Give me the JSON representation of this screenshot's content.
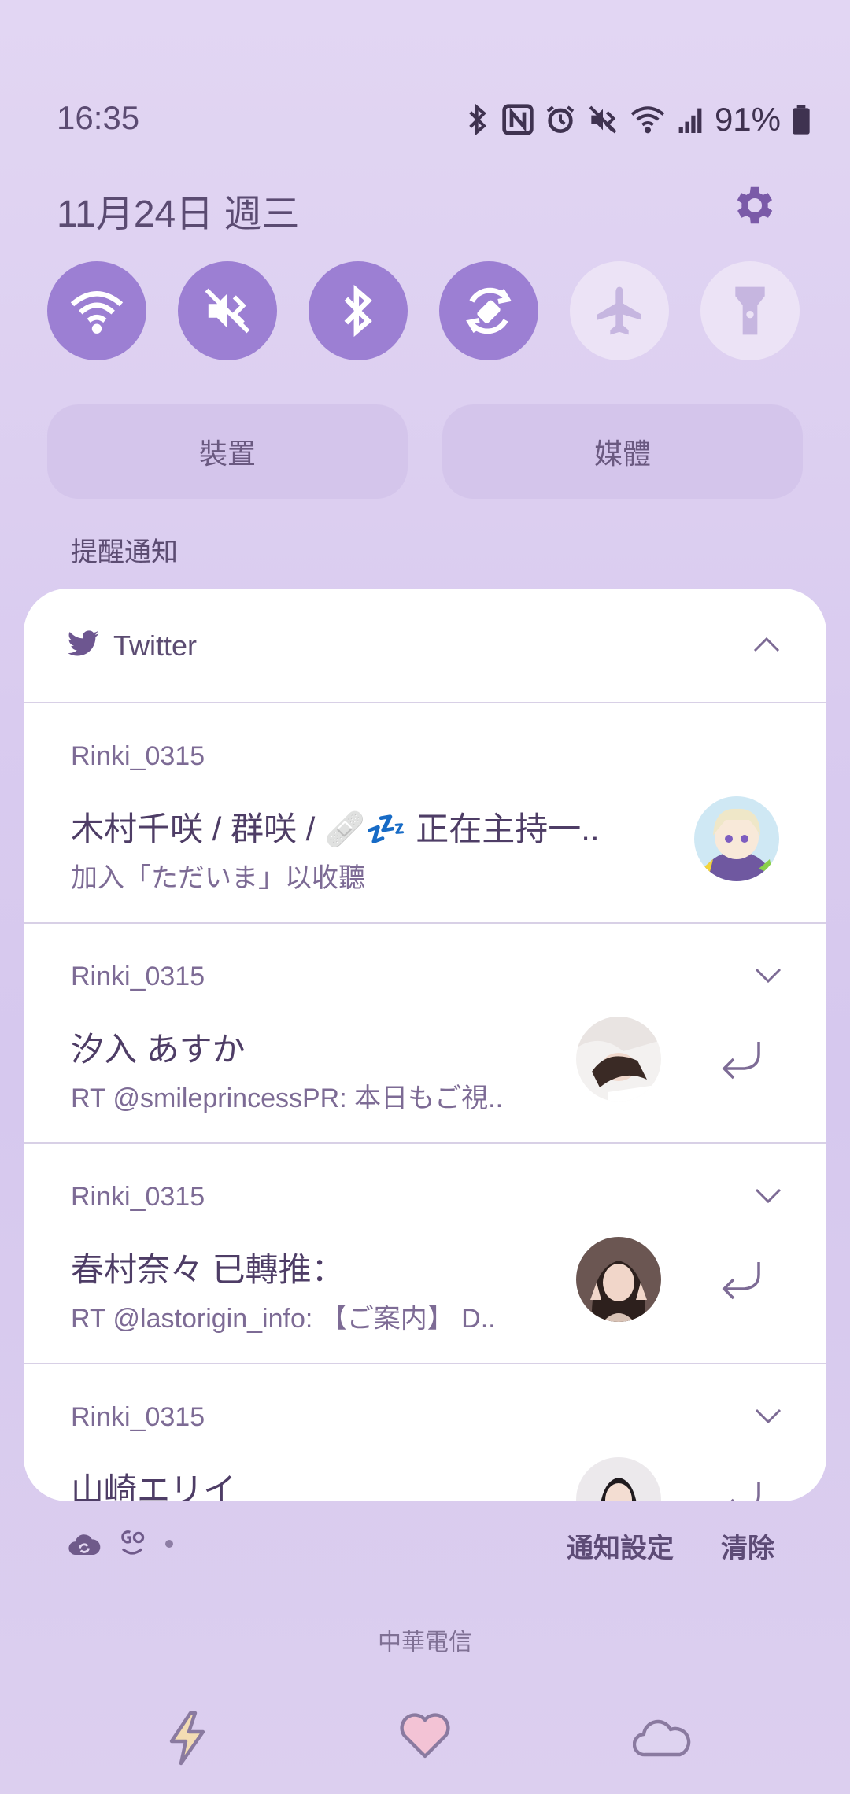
{
  "status_bar": {
    "time": "16:35",
    "battery": "91%",
    "icons": [
      "bluetooth-icon",
      "nfc-icon",
      "alarm-icon",
      "mute-icon",
      "wifi-icon",
      "signal-icon",
      "battery-icon"
    ]
  },
  "header": {
    "date": "11月24日 週三"
  },
  "quick_toggles": [
    {
      "name": "wifi",
      "state": "on"
    },
    {
      "name": "sound-mute",
      "state": "on"
    },
    {
      "name": "bluetooth",
      "state": "on"
    },
    {
      "name": "auto-rotate",
      "state": "on"
    },
    {
      "name": "airplane-mode",
      "state": "off"
    },
    {
      "name": "flashlight",
      "state": "off"
    }
  ],
  "buttons": {
    "devices": "裝置",
    "media": "媒體"
  },
  "section_label": "提醒通知",
  "card": {
    "app_name": "Twitter",
    "notifications": [
      {
        "account": "Rinki_0315",
        "title": "木村千咲 / 群咲 / 🩹💤 正在主持一..",
        "body": "加入「ただいま」以收聽"
      },
      {
        "account": "Rinki_0315",
        "title": "汐入 あすか",
        "body": "RT @smileprincessPR: 本日もご視.."
      },
      {
        "account": "Rinki_0315",
        "title": "春村奈々 已轉推：",
        "body": "RT @lastorigin_info: 【ご案内】 D.."
      },
      {
        "account": "Rinki_0315",
        "title": "山崎エリイ",
        "body": ""
      }
    ]
  },
  "footer": {
    "notification_settings": "通知設定",
    "clear": "清除",
    "carrier": "中華電信"
  },
  "colors": {
    "toggle_on": "#9c7fd3",
    "toggle_off": "#ece3f6",
    "card_bg": "#ffffff",
    "accent_text": "#5a4770"
  }
}
